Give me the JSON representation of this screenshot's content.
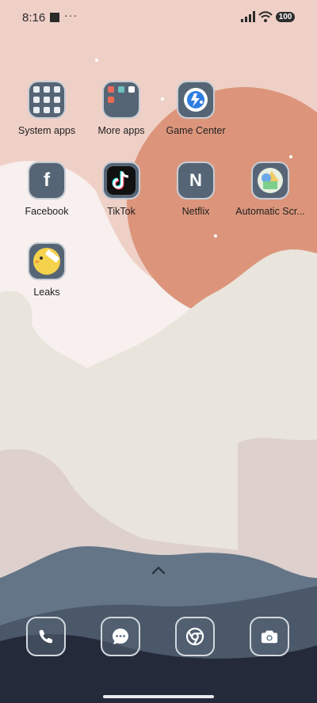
{
  "status_bar": {
    "time": "8:16",
    "battery": "100",
    "more": "···"
  },
  "apps": [
    {
      "label": "System apps",
      "icon": "folder-grid-icon"
    },
    {
      "label": "More apps",
      "icon": "folder-apps-icon"
    },
    {
      "label": "Game Center",
      "icon": "game-center-icon"
    },
    {
      "label": "Facebook",
      "icon": "facebook-icon",
      "glyph": "f"
    },
    {
      "label": "TikTok",
      "icon": "tiktok-icon"
    },
    {
      "label": "Netflix",
      "icon": "netflix-icon",
      "glyph": "N"
    },
    {
      "label": "Automatic Scr...",
      "icon": "shapes-icon"
    },
    {
      "label": "Leaks",
      "icon": "duck-icon"
    }
  ],
  "dock": [
    {
      "icon": "phone-icon"
    },
    {
      "icon": "messages-icon"
    },
    {
      "icon": "chrome-icon"
    },
    {
      "icon": "camera-icon"
    }
  ],
  "colors": {
    "sun": "#dc957b",
    "sky": "#efd0c7",
    "tile": "#566575"
  }
}
